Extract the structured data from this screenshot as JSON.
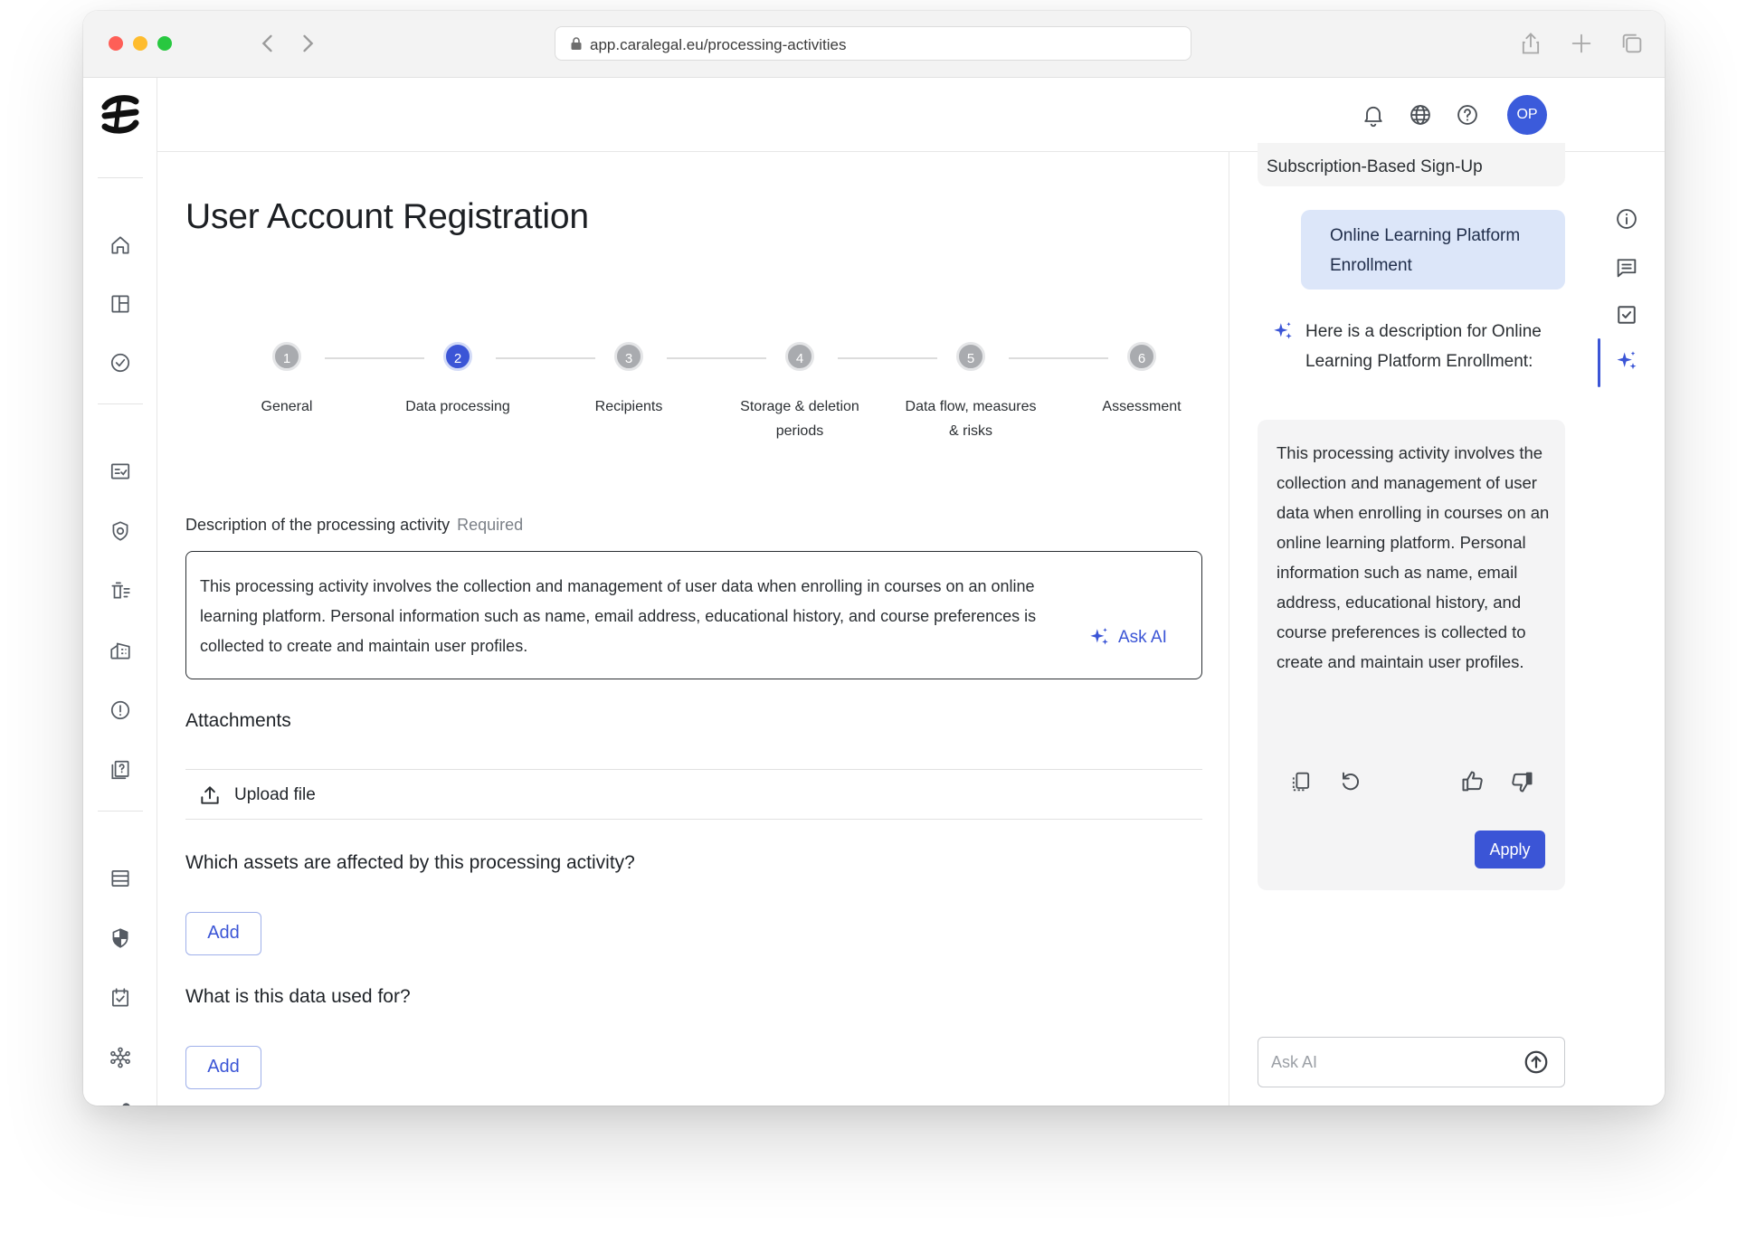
{
  "browser": {
    "url": "app.caralegal.eu/processing-activities"
  },
  "header": {
    "avatar_initials": "OP"
  },
  "page": {
    "title": "User Account Registration"
  },
  "stepper": {
    "steps": [
      {
        "number": "1",
        "label_line1": "General",
        "label_line2": "",
        "state": "pending"
      },
      {
        "number": "2",
        "label_line1": "Data processing",
        "label_line2": "",
        "state": "active"
      },
      {
        "number": "3",
        "label_line1": "Recipients",
        "label_line2": "",
        "state": "pending"
      },
      {
        "number": "4",
        "label_line1": "Storage & deletion",
        "label_line2": "periods",
        "state": "pending"
      },
      {
        "number": "5",
        "label_line1": "Data flow, measures",
        "label_line2": "& risks",
        "state": "pending"
      },
      {
        "number": "6",
        "label_line1": "Assessment",
        "label_line2": "",
        "state": "pending"
      }
    ]
  },
  "description": {
    "label": "Description of the processing activity",
    "required_label": "Required",
    "value": "This processing activity involves the collection and management of user data when enrolling in courses on an online learning platform. Personal information such as name, email address, educational history, and course preferences is collected to create and maintain user profiles.",
    "ask_ai_label": "Ask AI"
  },
  "attachments": {
    "heading": "Attachments",
    "upload_label": "Upload file"
  },
  "assets": {
    "question": "Which assets are affected by this processing activity?",
    "add_label": "Add"
  },
  "usage": {
    "question": "What is this data used for?",
    "add_label": "Add"
  },
  "ai_panel": {
    "previous_suggestion": "Subscription-Based Sign-Up",
    "user_message": "Online Learning Platform Enrollment",
    "ai_intro": "Here is a description for Online Learning Platform Enrollment:",
    "ai_response": "This processing activity involves the collection and management of user data when enrolling in courses on an online learning platform. Personal information such as name, email address, educational history, and course preferences is collected to create and maintain user profiles.",
    "apply_label": "Apply",
    "input_placeholder": "Ask AI"
  },
  "colors": {
    "accent": "#3b55d6",
    "user_bubble": "#dce6f9",
    "card_bg": "#f4f4f5"
  }
}
